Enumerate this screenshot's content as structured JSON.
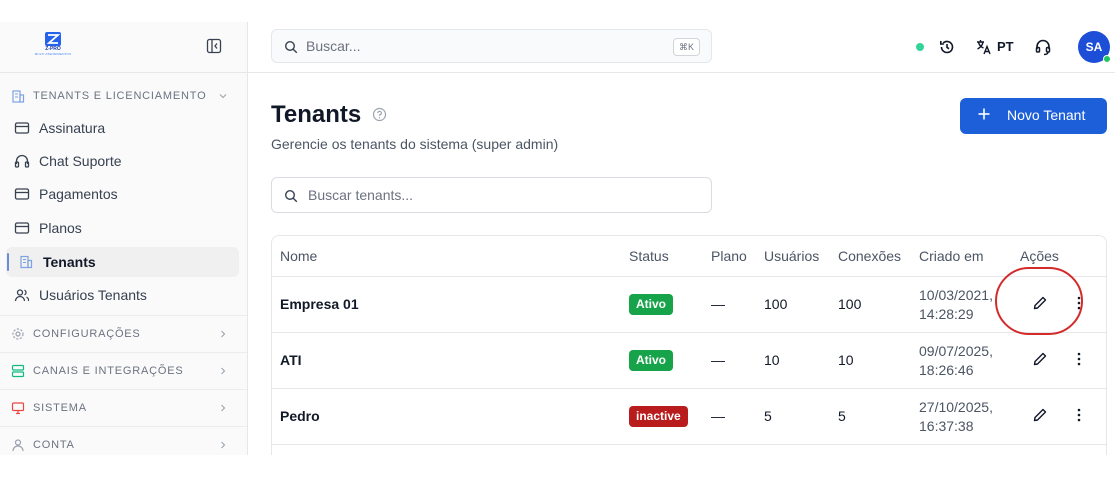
{
  "logo": {
    "brand": "Z-PRO",
    "tagline": "MULTI ATENDIMENTOS"
  },
  "sidebar": {
    "section_tenants": {
      "label": "TENANTS E LICENCIAMENTO",
      "icon": "building-icon"
    },
    "items": [
      {
        "label": "Assinatura",
        "icon": "card-icon"
      },
      {
        "label": "Chat Suporte",
        "icon": "headset-icon"
      },
      {
        "label": "Pagamentos",
        "icon": "card-icon"
      },
      {
        "label": "Planos",
        "icon": "card-icon"
      },
      {
        "label": "Tenants",
        "icon": "building-icon",
        "active": true
      },
      {
        "label": "Usuários Tenants",
        "icon": "users-icon"
      }
    ],
    "sections": [
      {
        "label": "CONFIGURAÇÕES",
        "icon": "gear-icon"
      },
      {
        "label": "CANAIS E INTEGRAÇÕES",
        "icon": "server-icon"
      },
      {
        "label": "SISTEMA",
        "icon": "monitor-icon"
      },
      {
        "label": "CONTA",
        "icon": "user-icon"
      }
    ]
  },
  "topbar": {
    "search_placeholder": "Buscar...",
    "shortcut": "⌘K",
    "language": "PT",
    "avatar_initials": "SA"
  },
  "page": {
    "title": "Tenants",
    "subtitle": "Gerencie os tenants do sistema (super admin)",
    "new_button": "Novo Tenant",
    "search_placeholder": "Buscar tenants..."
  },
  "table": {
    "headers": [
      "Nome",
      "Status",
      "Plano",
      "Usuários",
      "Conexões",
      "Criado em",
      "Ações"
    ],
    "rows": [
      {
        "name": "Empresa 01",
        "status": "Ativo",
        "plano": "—",
        "users": "100",
        "conns": "100",
        "date_line1": "10/03/2021,",
        "date_line2": "14:28:29"
      },
      {
        "name": "ATI",
        "status": "Ativo",
        "plano": "—",
        "users": "10",
        "conns": "10",
        "date_line1": "09/07/2025,",
        "date_line2": "18:26:46"
      },
      {
        "name": "Pedro",
        "status": "inactive",
        "plano": "—",
        "users": "5",
        "conns": "5",
        "date_line1": "27/10/2025,",
        "date_line2": "16:37:38"
      }
    ]
  },
  "colors": {
    "primary": "#1d5fd9",
    "active_badge": "#16a34a",
    "inactive_badge": "#b91c1c",
    "annotation": "#d42a2a"
  }
}
